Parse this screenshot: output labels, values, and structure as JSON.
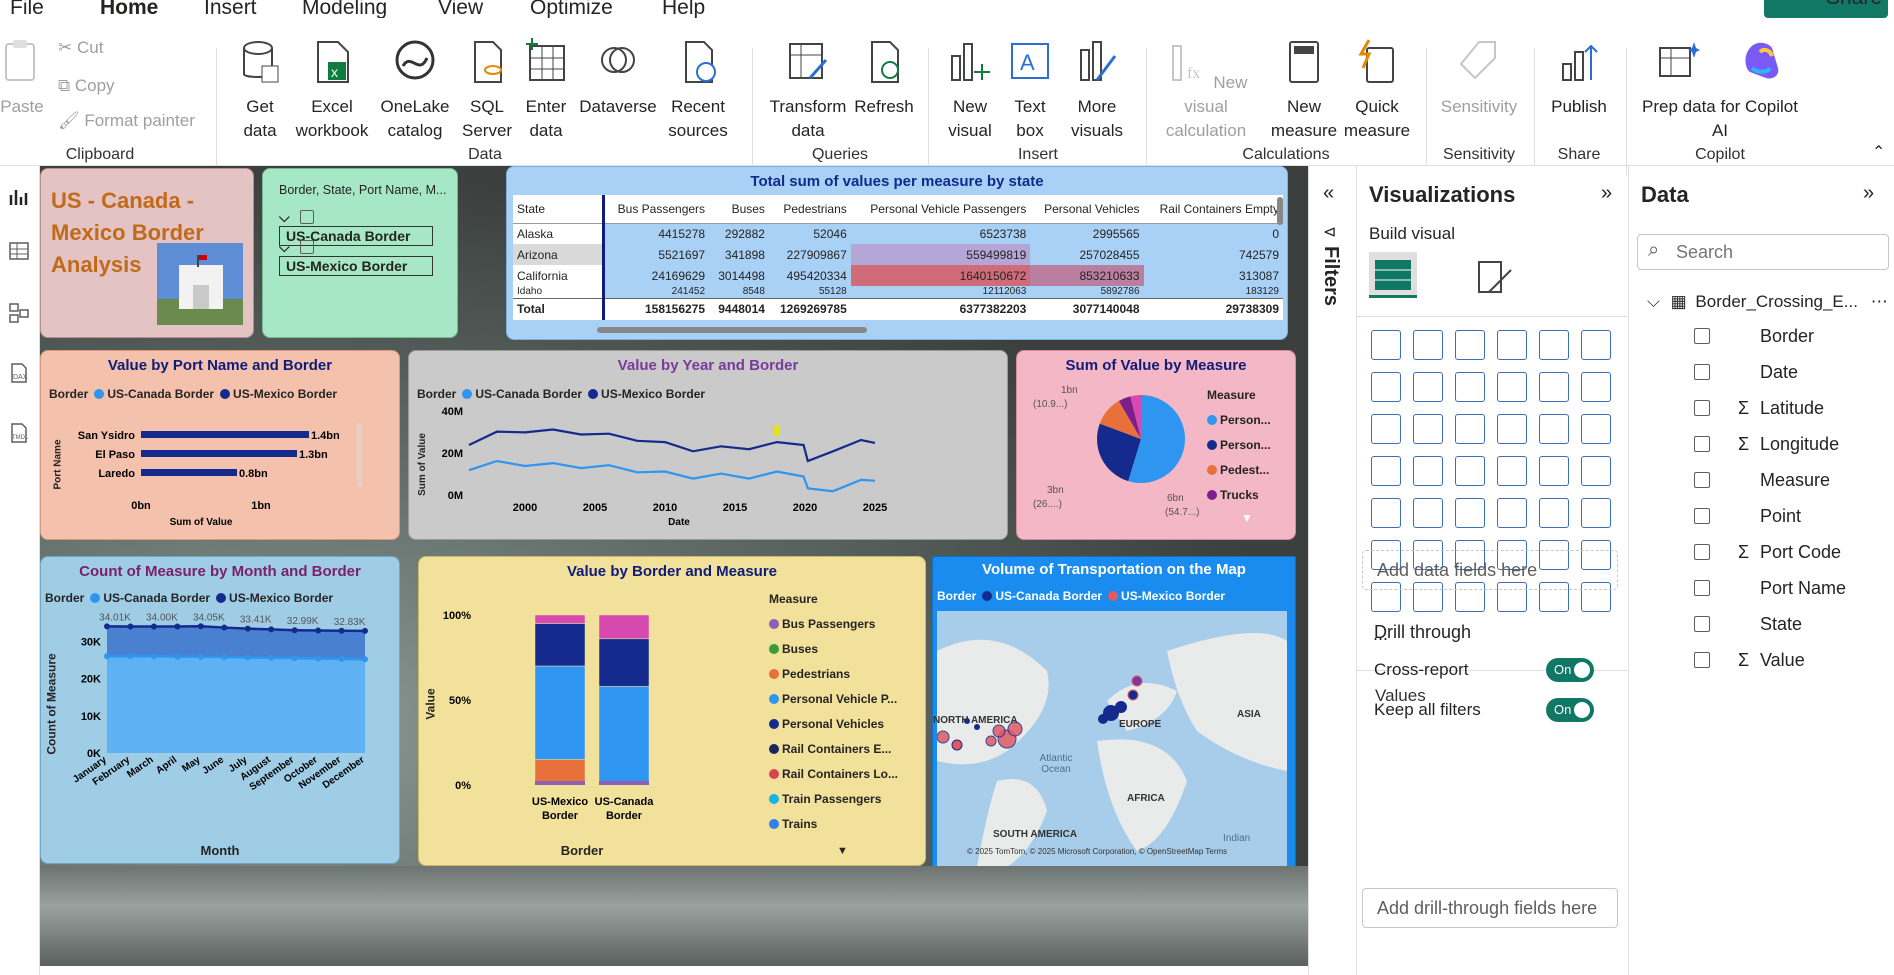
{
  "tabs": {
    "file": "File",
    "home": "Home",
    "insert": "Insert",
    "modeling": "Modeling",
    "view": "View",
    "optimize": "Optimize",
    "help": "Help",
    "share": "Share"
  },
  "ribbon": {
    "clipboard": {
      "paste": "Paste",
      "cut": "Cut",
      "copy": "Copy",
      "format_painter": "Format painter",
      "label": "Clipboard"
    },
    "data": {
      "get_data": "Get data",
      "excel": "Excel workbook",
      "onelake": "OneLake catalog",
      "sql": "SQL Server",
      "enter": "Enter data",
      "dataverse": "Dataverse",
      "recent": "Recent sources",
      "label": "Data"
    },
    "queries": {
      "transform": "Transform data",
      "refresh": "Refresh",
      "label": "Queries"
    },
    "insert": {
      "new_visual": "New visual",
      "text_box": "Text box",
      "more_visuals": "More visuals",
      "label": "Insert"
    },
    "calculations": {
      "new_visual_calc": "New visual calculation",
      "new_measure": "New measure",
      "quick_measure": "Quick measure",
      "label": "Calculations"
    },
    "sensitivity": {
      "sensitivity": "Sensitivity",
      "label": "Sensitivity"
    },
    "share": {
      "publish": "Publish",
      "label": "Share"
    },
    "copilot": {
      "prep": "Prep data for Copilot AI",
      "label": "Copilot"
    }
  },
  "report": {
    "title": "US - Canada - Mexico Border Analysis",
    "slicer": {
      "header": "Border, State, Port Name, M...",
      "items": [
        "US-Canada Border",
        "US-Mexico Border"
      ]
    },
    "matrix": {
      "title": "Total sum of values per measure by state",
      "columns": [
        "State",
        "Bus Passengers",
        "Buses",
        "Pedestrians",
        "Personal Vehicle Passengers",
        "Personal Vehicles",
        "Rail Containers Empty"
      ],
      "rows": [
        [
          "Alaska",
          "4415278",
          "292882",
          "52046",
          "6523738",
          "2995565",
          "0"
        ],
        [
          "Arizona",
          "5521697",
          "341898",
          "227909867",
          "559499819",
          "257028455",
          "742579"
        ],
        [
          "California",
          "24169629",
          "3014498",
          "495420334",
          "1640150672",
          "853210633",
          "313087"
        ],
        [
          "Idaho",
          "241452",
          "8548",
          "55128",
          "12112063",
          "5892786",
          "183129"
        ]
      ],
      "total": [
        "Total",
        "158156275",
        "9448014",
        "1269269785",
        "6377382203",
        "3077140048",
        "29738309"
      ]
    },
    "port_chart": {
      "title": "Value by Port Name and Border",
      "legend_title": "Border",
      "ylabel": "Port Name",
      "xlabel": "Sum of Value",
      "series": [
        "US-Canada Border",
        "US-Mexico Border"
      ],
      "chart_data": {
        "type": "bar",
        "categories": [
          "San Ysidro",
          "El Paso",
          "Laredo"
        ],
        "values": [
          1.4,
          1.3,
          0.8
        ],
        "labels": [
          "1.4bn",
          "1.3bn",
          "0.8bn"
        ],
        "xticks": [
          "0bn",
          "1bn"
        ]
      }
    },
    "year_chart": {
      "title": "Value by Year and Border",
      "legend_title": "Border",
      "ylabel": "Sum of Value",
      "xlabel": "Date",
      "series": [
        "US-Canada Border",
        "US-Mexico Border"
      ],
      "yticks": [
        "40M",
        "20M",
        "0M"
      ],
      "xticks": [
        "2000",
        "2005",
        "2010",
        "2015",
        "2020",
        "2025"
      ],
      "chart_data": {
        "type": "line",
        "x": [
          1996,
          1998,
          2000,
          2002,
          2004,
          2006,
          2008,
          2010,
          2012,
          2014,
          2016,
          2018,
          2019.9,
          2020.2,
          2022,
          2024,
          2025
        ],
        "series": [
          {
            "name": "US-Mexico Border",
            "values": [
              25,
              29,
              31,
              30,
              30,
              28,
              27,
              24,
              22,
              22,
              23,
              24,
              25,
              15,
              22,
              25,
              26
            ]
          },
          {
            "name": "US-Canada Border",
            "values": [
              13,
              15,
              15,
              14,
              14,
              13,
              12,
              10,
              9,
              9,
              9,
              10,
              10,
              2,
              3,
              6,
              8
            ]
          }
        ],
        "ylim": [
          0,
          40
        ]
      }
    },
    "pie_chart": {
      "title": "Sum of Value by Measure",
      "legend_title": "Measure",
      "legend": [
        "Person...",
        "Person...",
        "Pedest...",
        "Trucks"
      ],
      "labels": [
        "1bn",
        "(10.9...)",
        "3bn",
        "(26....)",
        "6bn",
        "(54.7...)"
      ],
      "chart_data": {
        "type": "pie",
        "categories": [
          "Personal Vehicle Passengers",
          "Personal Vehicles",
          "Pedestrians",
          "Trucks",
          "Other"
        ],
        "values": [
          54.7,
          26,
          10.9,
          4.5,
          3.9
        ]
      }
    },
    "month_chart": {
      "title": "Count of Measure by Month and Border",
      "legend_title": "Border",
      "series": [
        "US-Canada Border",
        "US-Mexico Border"
      ],
      "ylabel": "Count of Measure",
      "xlabel": "Month",
      "yticks": [
        "30K",
        "20K",
        "10K",
        "0K"
      ],
      "data_labels": [
        "34.01K",
        "34.00K",
        "34.05K",
        "33.41K",
        "32.99K",
        "32.83K"
      ],
      "chart_data": {
        "type": "area",
        "categories": [
          "January",
          "February",
          "March",
          "April",
          "May",
          "June",
          "July",
          "August",
          "September",
          "October",
          "November",
          "December"
        ],
        "series": [
          {
            "name": "US-Mexico Border",
            "values": [
              34.01,
              34.0,
              34.0,
              34.0,
              34.05,
              33.7,
              33.41,
              33.2,
              32.99,
              32.9,
              32.83,
              32.8
            ]
          },
          {
            "name": "US-Canada Border",
            "values": [
              26,
              26,
              26,
              25.9,
              25.9,
              25.8,
              25.7,
              25.6,
              25.5,
              25.4,
              25.3,
              25.2
            ]
          }
        ],
        "ylim": [
          0,
          36
        ]
      }
    },
    "stack_chart": {
      "title": "Value by Border and Measure",
      "legend_title": "Measure",
      "ylabel": "Value",
      "xlabel": "Border",
      "yticks": [
        "100%",
        "50%",
        "0%"
      ],
      "legend": [
        "Bus Passengers",
        "Buses",
        "Pedestrians",
        "Personal Vehicle P...",
        "Personal Vehicles",
        "Rail Containers E...",
        "Rail Containers Lo...",
        "Train Passengers",
        "Trains"
      ],
      "colors": [
        "#8e5fb5",
        "#3a9b3a",
        "#e8703a",
        "#2e96f0",
        "#142a8c",
        "#1b2560",
        "#d64550",
        "#15b4e6",
        "#2f80ed"
      ],
      "chart_data": {
        "type": "bar",
        "categories": [
          "US-Mexico Border",
          "US-Canada Border"
        ],
        "series": [
          {
            "name": "Pedestrians",
            "values": [
              15,
              0
            ]
          },
          {
            "name": "Personal Vehicle Passengers",
            "values": [
              55,
              58
            ]
          },
          {
            "name": "Personal Vehicles",
            "values": [
              25,
              28
            ]
          },
          {
            "name": "Other",
            "values": [
              5,
              14
            ]
          }
        ]
      }
    },
    "map": {
      "title": "Volume of Transportation on the Map",
      "legend_title": "Border",
      "series": [
        "US-Canada Border",
        "US-Mexico Border"
      ],
      "labels": [
        "NORTH AMERICA",
        "EUROPE",
        "ASIA",
        "Atlantic Ocean",
        "AFRICA",
        "SOUTH AMERICA",
        "Indian"
      ],
      "attribution": "© 2025 TomTom, © 2025 Microsoft Corporation, © OpenStreetMap Terms"
    }
  },
  "filters": {
    "label": "Filters"
  },
  "visualizations": {
    "title": "Visualizations",
    "build_visual": "Build visual",
    "values_label": "Values",
    "values_placeholder": "Add data fields here",
    "drill_through": "Drill through",
    "cross_report": "Cross-report",
    "keep_filters": "Keep all filters",
    "toggle_on": "On",
    "drill_placeholder": "Add drill-through fields here",
    "more": "..."
  },
  "data_pane": {
    "title": "Data",
    "search_placeholder": "Search",
    "table": "Border_Crossing_E...",
    "fields": [
      {
        "name": "Border",
        "sigma": false
      },
      {
        "name": "Date",
        "sigma": false
      },
      {
        "name": "Latitude",
        "sigma": true
      },
      {
        "name": "Longitude",
        "sigma": true
      },
      {
        "name": "Measure",
        "sigma": false
      },
      {
        "name": "Point",
        "sigma": false
      },
      {
        "name": "Port Code",
        "sigma": true
      },
      {
        "name": "Port Name",
        "sigma": false
      },
      {
        "name": "State",
        "sigma": false
      },
      {
        "name": "Value",
        "sigma": true
      }
    ]
  },
  "colors": {
    "accent": "#117865",
    "canada": "#2e96f0",
    "mexico": "#142a8c"
  }
}
